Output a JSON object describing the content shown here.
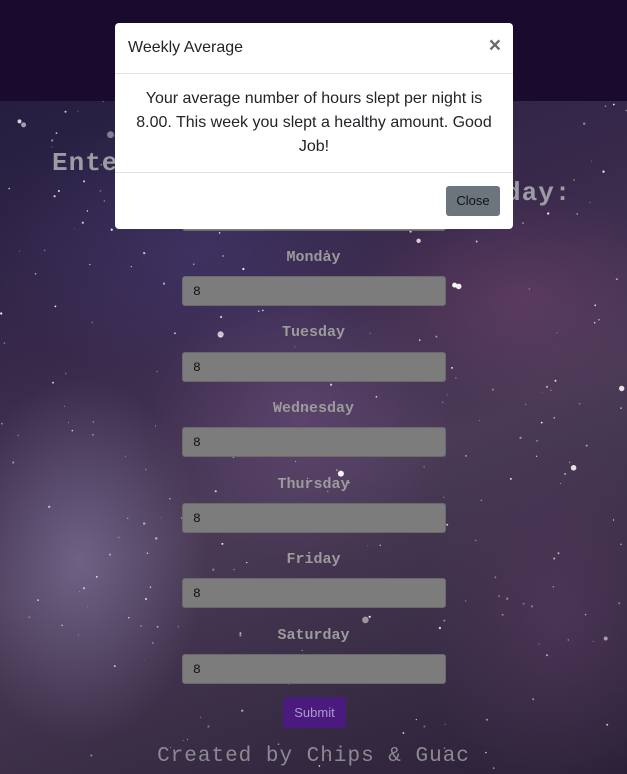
{
  "heading": {
    "left": "Ente",
    "right": "day:"
  },
  "days": [
    {
      "label": "Monday",
      "value": "8"
    },
    {
      "label": "Tuesday",
      "value": "8"
    },
    {
      "label": "Wednesday",
      "value": "8"
    },
    {
      "label": "Thursday",
      "value": "8"
    },
    {
      "label": "Friday",
      "value": "8"
    },
    {
      "label": "Saturday",
      "value": "8"
    }
  ],
  "submit_label": "Submit",
  "footer": "Created by Chips & Guac",
  "modal": {
    "title": "Weekly Average",
    "close_x": "×",
    "body": "Your average number of hours slept per night is 8.00. This week you slept a healthy amount. Good Job!",
    "close_label": "Close"
  },
  "colors": {
    "navbar": "#1a0a2e",
    "submit": "#4a1a7e",
    "close": "#6c757d"
  }
}
